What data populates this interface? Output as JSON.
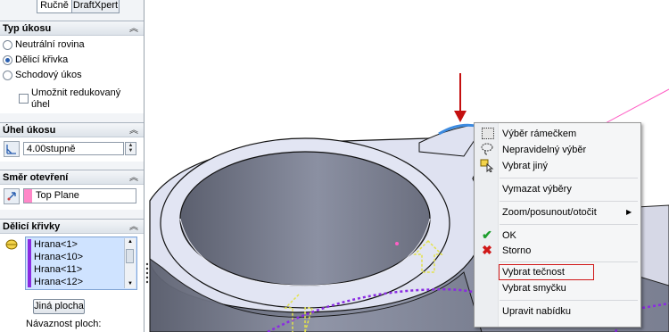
{
  "tabs": {
    "manual": "Ručně",
    "draftxpert": "DraftXpert"
  },
  "draft_type": {
    "title": "Typ úkosu",
    "options": [
      "Neutrální rovina",
      "Dělicí křivka",
      "Schodový úkos"
    ],
    "selected": "Dělicí křivka",
    "reduced_angle_label_1": "Umožnit redukovaný",
    "reduced_angle_label_2": "úhel"
  },
  "draft_angle": {
    "title": "Úhel úkosu",
    "value": "4.00stupně"
  },
  "pull_direction": {
    "title": "Směr otevření",
    "value": "Top Plane"
  },
  "parting_lines": {
    "title": "Dělicí křivky",
    "items": [
      "Hrana<1>",
      "Hrana<10>",
      "Hrana<11>",
      "Hrana<12>"
    ],
    "other_face_button": "Jiná plocha",
    "face_propagation_label": "Návaznost ploch:"
  },
  "context_menu": {
    "items": {
      "box_select": "Výběr rámečkem",
      "lasso_select": "Nepravidelný výběr",
      "select_other": "Vybrat jiný",
      "clear_selections": "Vymazat výběry",
      "zoom_pan_rotate": "Zoom/posunout/otočit",
      "ok": "OK",
      "cancel": "Storno",
      "select_tangency": "Vybrat tečnost",
      "select_loop": "Vybrat smyčku",
      "customize_menu": "Upravit nabídku"
    },
    "highlighted": "Vybrat tečnost"
  },
  "colors": {
    "accent_purple": "#8a2be2",
    "pink": "#ff6fc8",
    "highlight_red": "#d01818",
    "arrow_red": "#c41010",
    "selected_edge_blue": "#3d8be0"
  }
}
